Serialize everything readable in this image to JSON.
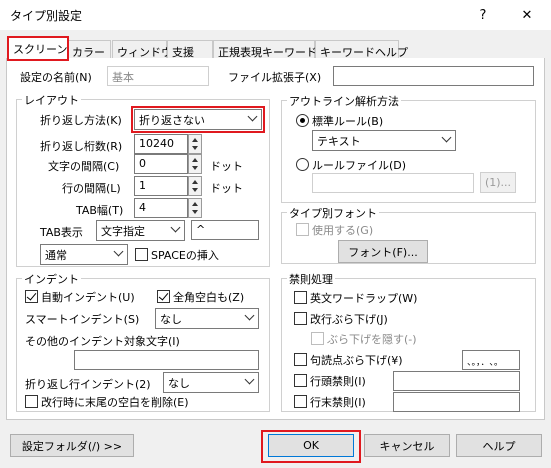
{
  "window": {
    "title": "タイプ別設定",
    "help_glyph": "?",
    "close_glyph": "✕"
  },
  "tabs": [
    {
      "label": "スクリーン"
    },
    {
      "label": "カラー"
    },
    {
      "label": "ウィンドウ"
    },
    {
      "label": "支援"
    },
    {
      "label": "正規表現キーワード"
    },
    {
      "label": "キーワードヘルプ"
    }
  ],
  "top": {
    "name_label": "設定の名前(N)",
    "name_value": "基本",
    "ext_label": "ファイル拡張子(X)",
    "ext_value": ""
  },
  "layout": {
    "title": "レイアウト",
    "wrap_method_label": "折り返し方法(K)",
    "wrap_method_value": "折り返さない",
    "wrap_cols_label": "折り返し桁数(R)",
    "wrap_cols_value": "10240",
    "char_spacing_label": "文字の間隔(C)",
    "char_spacing_value": "0",
    "char_spacing_unit": "ドット",
    "line_spacing_label": "行の間隔(L)",
    "line_spacing_value": "1",
    "line_spacing_unit": "ドット",
    "tab_width_label": "TAB幅(T)",
    "tab_width_value": "4",
    "tab_display_label": "TAB表示",
    "tab_display_value": "文字指定",
    "tab_char_value": "^",
    "mode_value": "通常",
    "space_insert_label": "SPACEの挿入"
  },
  "outline": {
    "title": "アウトライン解析方法",
    "standard_rule_label": "標準ルール(B)",
    "standard_rule_value": "テキスト",
    "rule_file_label": "ルールファイル(D)",
    "rule_file_value": "",
    "browse_label": "(1)..."
  },
  "font": {
    "title": "タイプ別フォント",
    "use_label": "使用する(G)",
    "font_button": "フォント(F)..."
  },
  "indent": {
    "title": "インデント",
    "auto_indent_label": "自動インデント(U)",
    "fullwidth_space_label": "全角空白も(Z)",
    "smart_indent_label": "スマートインデント(S)",
    "smart_indent_value": "なし",
    "other_chars_label": "その他のインデント対象文字(I)",
    "other_chars_value": "",
    "wrap_indent_label": "折り返し行インデント(2)",
    "wrap_indent_value": "なし",
    "trim_trailing_label": "改行時に末尾の空白を削除(E)"
  },
  "kinsoku": {
    "title": "禁則処理",
    "word_wrap_label": "英文ワードラップ(W)",
    "newline_hang_label": "改行ぶら下げ(J)",
    "hide_hang_label": "ぶら下げを隠す(-)",
    "punct_hang_label": "句読点ぶら下げ(¥)",
    "punct_value": "、。，．､｡",
    "line_head_label": "行頭禁則(I)",
    "line_tail_label": "行末禁則(I)"
  },
  "footer": {
    "folder_button": "設定フォルダ(/) >>",
    "ok_button": "OK",
    "cancel_button": "キャンセル",
    "help_button": "ヘルプ"
  },
  "colors": {
    "highlight": "#e0191f"
  }
}
